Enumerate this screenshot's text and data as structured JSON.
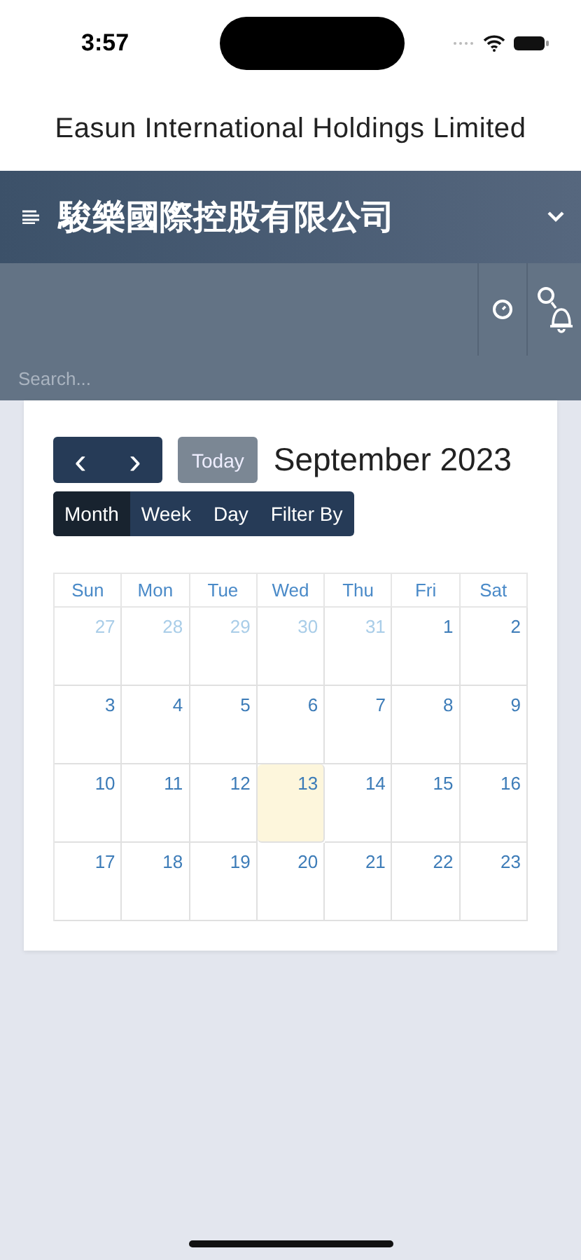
{
  "status_bar": {
    "time": "3:57"
  },
  "app_title": "Easun International Holdings Limited",
  "header": {
    "company": "駿樂國際控股有限公司"
  },
  "search": {
    "placeholder": "Search..."
  },
  "calendar": {
    "today_button": "Today",
    "prev": "‹",
    "next": "›",
    "month_title": "September 2023",
    "views": [
      {
        "label": "Month",
        "selected": true
      },
      {
        "label": "Week",
        "selected": false
      },
      {
        "label": "Day",
        "selected": false
      },
      {
        "label": "Filter By",
        "selected": false
      }
    ],
    "weekdays": [
      "Sun",
      "Mon",
      "Tue",
      "Wed",
      "Thu",
      "Fri",
      "Sat"
    ],
    "weeks": [
      [
        {
          "day": "27",
          "outside": true,
          "today": false
        },
        {
          "day": "28",
          "outside": true,
          "today": false
        },
        {
          "day": "29",
          "outside": true,
          "today": false
        },
        {
          "day": "30",
          "outside": true,
          "today": false
        },
        {
          "day": "31",
          "outside": true,
          "today": false
        },
        {
          "day": "1",
          "outside": false,
          "today": false
        },
        {
          "day": "2",
          "outside": false,
          "today": false
        }
      ],
      [
        {
          "day": "3",
          "outside": false,
          "today": false
        },
        {
          "day": "4",
          "outside": false,
          "today": false
        },
        {
          "day": "5",
          "outside": false,
          "today": false
        },
        {
          "day": "6",
          "outside": false,
          "today": false
        },
        {
          "day": "7",
          "outside": false,
          "today": false
        },
        {
          "day": "8",
          "outside": false,
          "today": false
        },
        {
          "day": "9",
          "outside": false,
          "today": false
        }
      ],
      [
        {
          "day": "10",
          "outside": false,
          "today": false
        },
        {
          "day": "11",
          "outside": false,
          "today": false
        },
        {
          "day": "12",
          "outside": false,
          "today": false
        },
        {
          "day": "13",
          "outside": false,
          "today": true
        },
        {
          "day": "14",
          "outside": false,
          "today": false
        },
        {
          "day": "15",
          "outside": false,
          "today": false
        },
        {
          "day": "16",
          "outside": false,
          "today": false
        }
      ],
      [
        {
          "day": "17",
          "outside": false,
          "today": false
        },
        {
          "day": "18",
          "outside": false,
          "today": false
        },
        {
          "day": "19",
          "outside": false,
          "today": false
        },
        {
          "day": "20",
          "outside": false,
          "today": false
        },
        {
          "day": "21",
          "outside": false,
          "today": false
        },
        {
          "day": "22",
          "outside": false,
          "today": false
        },
        {
          "day": "23",
          "outside": false,
          "today": false
        }
      ]
    ]
  }
}
